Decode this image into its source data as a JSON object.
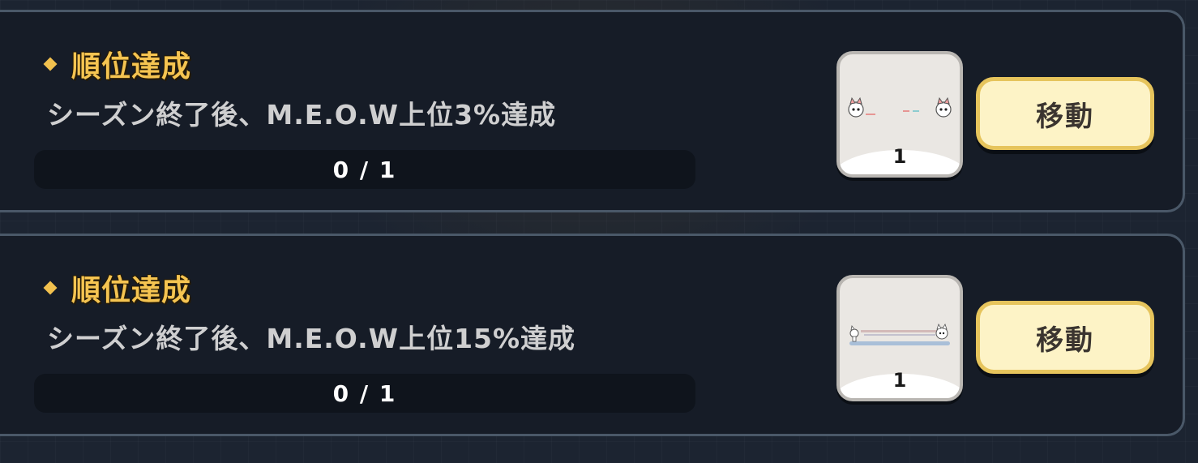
{
  "quests": [
    {
      "title": "順位達成",
      "description": "シーズン終了後、M.E.O.W上位3%達成",
      "progress_text": "0 / 1",
      "progress_fraction": 0,
      "reward": {
        "icon": "cat-emote-reward-icon",
        "count": "1"
      },
      "button_label": "移動"
    },
    {
      "title": "順位達成",
      "description": "シーズン終了後、M.E.O.W上位15%達成",
      "progress_text": "0 / 1",
      "progress_fraction": 0,
      "reward": {
        "icon": "cat-dash-effect-reward-icon",
        "count": "1"
      },
      "button_label": "移動"
    }
  ],
  "colors": {
    "title": "#f5c451",
    "button_bg": "#fdf3c6",
    "button_border": "#e6c45c",
    "card_bg": "#161c27",
    "card_border": "#4a5868"
  }
}
